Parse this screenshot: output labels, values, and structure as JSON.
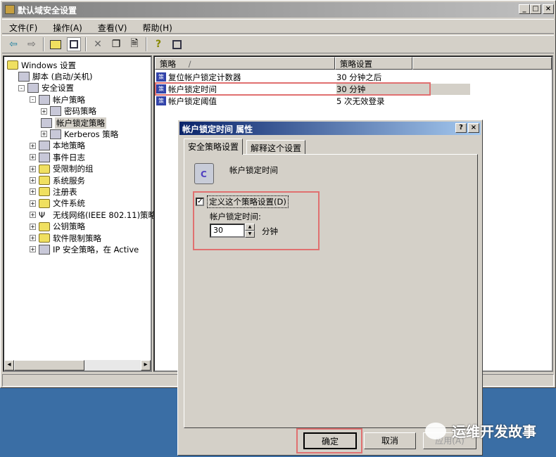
{
  "window": {
    "title": "默认域安全设置",
    "minimize": "_",
    "maximize": "□",
    "close": "×"
  },
  "menu": [
    "文件(F)",
    "操作(A)",
    "查看(V)",
    "帮助(H)"
  ],
  "toolbar_icons": [
    "back-icon",
    "forward-icon",
    "up-folder-icon",
    "show-tree-icon",
    "delete-icon",
    "properties-icon",
    "export-icon",
    "help-icon",
    "console-icon"
  ],
  "tree": [
    {
      "label": "Windows 设置",
      "level": 0,
      "icon": "folder"
    },
    {
      "label": "脚本 (启动/关机)",
      "level": 1,
      "icon": "script"
    },
    {
      "label": "安全设置",
      "level": 1,
      "icon": "security",
      "exp": "-"
    },
    {
      "label": "帐户策略",
      "level": 2,
      "icon": "policy",
      "exp": "-"
    },
    {
      "label": "密码策略",
      "level": 3,
      "icon": "policy",
      "exp": "+"
    },
    {
      "label": "帐户锁定策略",
      "level": 3,
      "icon": "policy",
      "selected": true
    },
    {
      "label": "Kerberos 策略",
      "level": 3,
      "icon": "policy",
      "exp": "+"
    },
    {
      "label": "本地策略",
      "level": 2,
      "icon": "policy",
      "exp": "+"
    },
    {
      "label": "事件日志",
      "level": 2,
      "icon": "policy",
      "exp": "+"
    },
    {
      "label": "受限制的组",
      "level": 2,
      "icon": "folder",
      "exp": "+"
    },
    {
      "label": "系统服务",
      "level": 2,
      "icon": "folder",
      "exp": "+"
    },
    {
      "label": "注册表",
      "level": 2,
      "icon": "folder",
      "exp": "+"
    },
    {
      "label": "文件系统",
      "level": 2,
      "icon": "folder",
      "exp": "+"
    },
    {
      "label": "无线网络(IEEE 802.11)策略",
      "level": 2,
      "icon": "antenna",
      "exp": "+"
    },
    {
      "label": "公钥策略",
      "level": 2,
      "icon": "folder",
      "exp": "+"
    },
    {
      "label": "软件限制策略",
      "level": 2,
      "icon": "folder",
      "exp": "+"
    },
    {
      "label": "IP 安全策略，在 Active",
      "level": 2,
      "icon": "ipsec",
      "exp": "+"
    }
  ],
  "list": {
    "headers": [
      "策略",
      "策略设置"
    ],
    "sort_indicator": "/",
    "rows": [
      {
        "policy": "复位帐户锁定计数器",
        "setting": "30 分钟之后"
      },
      {
        "policy": "帐户锁定时间",
        "setting": "30 分钟",
        "selected": true
      },
      {
        "policy": "帐户锁定阈值",
        "setting": "5 次无效登录"
      }
    ]
  },
  "dialog": {
    "title": "帐户锁定时间 属性",
    "help": "?",
    "close": "×",
    "tabs": [
      "安全策略设置",
      "解释这个设置"
    ],
    "policy_name": "帐户锁定时间",
    "checkbox_label": "定义这个策略设置(D)",
    "checked": true,
    "field_label": "帐户锁定时间:",
    "field_value": "30",
    "unit": "分钟",
    "buttons": {
      "ok": "确定",
      "cancel": "取消",
      "apply": "应用(A)"
    }
  },
  "watermark": "运维开发故事",
  "colors": {
    "desktop": "#3a6ea5",
    "dialog_title": "#0a246a",
    "highlight_box": "#e07070"
  }
}
